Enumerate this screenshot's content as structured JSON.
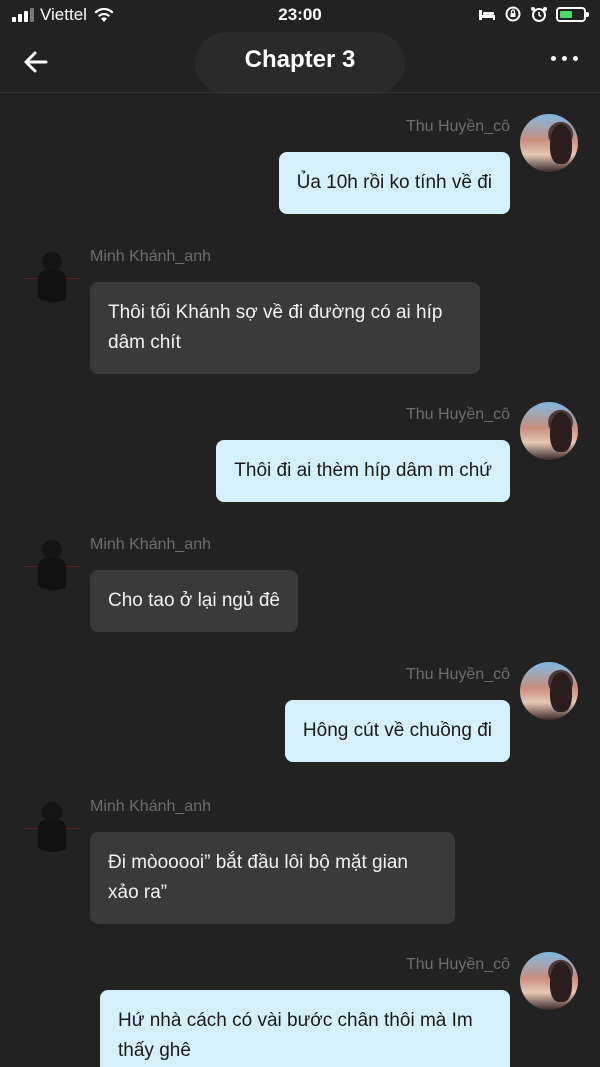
{
  "status_bar": {
    "carrier": "Viettel",
    "time": "23:00"
  },
  "header": {
    "title": "Chapter 3"
  },
  "messages": [
    {
      "side": "right",
      "sender": "Thu Huyền_cô",
      "text": "Ủa 10h rồi ko tính về đi"
    },
    {
      "side": "left",
      "sender": "Minh Khánh_anh",
      "text": "Thôi tối Khánh sợ về đi đường có ai híp dâm chít"
    },
    {
      "side": "right",
      "sender": "Thu Huyền_cô",
      "text": "Thôi đi ai thèm híp dâm m chứ"
    },
    {
      "side": "left",
      "sender": "Minh Khánh_anh",
      "text": "Cho tao ở lại ngủ đê"
    },
    {
      "side": "right",
      "sender": "Thu Huyền_cô",
      "text": "Hông cút về chuồng đi"
    },
    {
      "side": "left",
      "sender": "Minh Khánh_anh",
      "text": "Đi mòooooi” bắt đầu lôi bộ mặt gian xảo ra”"
    },
    {
      "side": "right",
      "sender": "Thu Huyền_cô",
      "text": "Hứ nhà cách có vài bước chân thôi mà Im thấy ghê"
    }
  ],
  "colors": {
    "background": "#222222",
    "bubble_right": "#d6f0fb",
    "bubble_left": "#3a3a3a",
    "sender_text": "#6e6e6e"
  }
}
